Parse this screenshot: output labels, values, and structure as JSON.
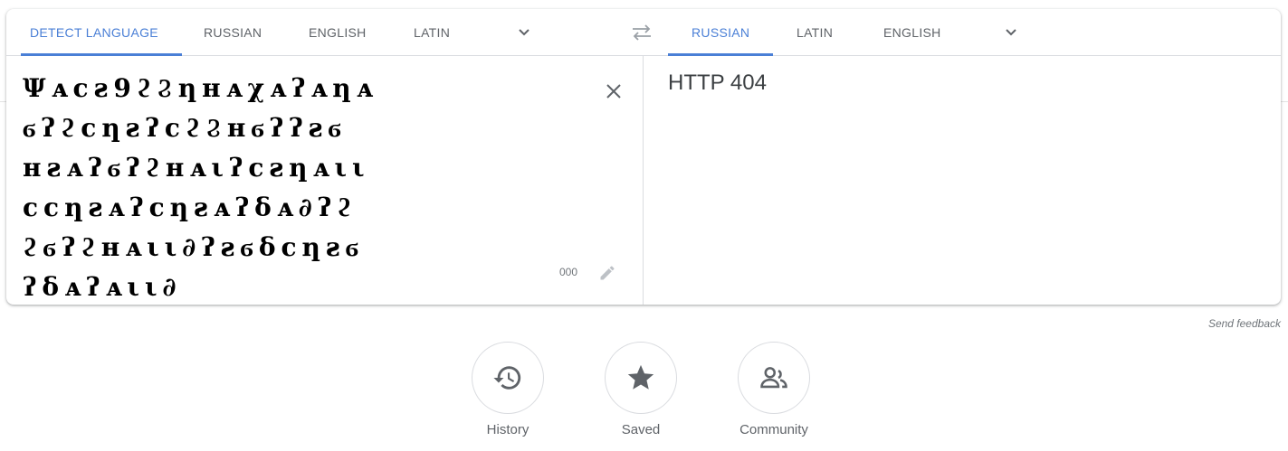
{
  "source_tabs": [
    "Detect language",
    "Russian",
    "English",
    "Latin"
  ],
  "target_tabs": [
    "Russian",
    "Latin",
    "English"
  ],
  "source_lines": [
    "Ψᴀϲƨ9ϩϨƞʜᴀχᴀʔᴀƞᴀ",
    "ϭʔϩϲƞƨʔϲϩϨʜϭʔʔƨϭ",
    "ʜƨᴀʔϭʔϩʜᴀιʔϲƨƞᴀιι",
    "ϲϲƞƨᴀʔϲƞƨᴀʔδᴀ∂ʔϩ",
    "ϩϭʔϩʜᴀιι∂ʔƨϭδϲƞƨϭ",
    "ʔδᴀʔᴀιι∂"
  ],
  "char_count": "000",
  "translation": "HTTP 404",
  "feedback_label": "Send feedback",
  "quick_actions": [
    {
      "label": "History",
      "icon": "history-icon"
    },
    {
      "label": "Saved",
      "icon": "star-icon"
    },
    {
      "label": "Community",
      "icon": "community-icon"
    }
  ],
  "colors": {
    "accent": "#4a7fd6",
    "muted": "#5f6368"
  }
}
